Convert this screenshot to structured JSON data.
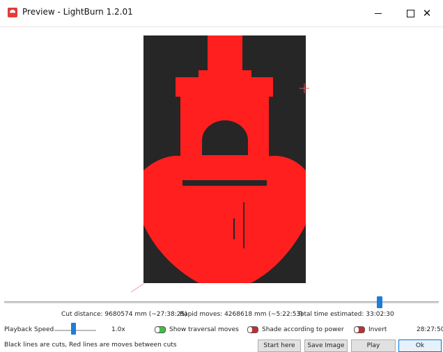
{
  "window": {
    "title": "Preview - LightBurn 1.2.01",
    "minimize_label": "—",
    "maximize_label": "□",
    "close_label": "✕"
  },
  "stats": {
    "cut_distance": "Cut distance: 9680574 mm (~27:38:25)",
    "rapid_moves": "Rapid moves: 4268618 mm (~5:22:53)",
    "total_time": "Total time estimated: 33:02:30"
  },
  "controls": {
    "playback_label": "Playback Speed",
    "speed_value": "1.0x",
    "show_traversal": "Show traversal moves",
    "shade_power": "Shade according to power",
    "invert": "Invert",
    "time_display": "28:27:50"
  },
  "status": {
    "text": "Black lines are cuts, Red lines are moves between cuts"
  },
  "buttons": {
    "start_here": "Start here",
    "save_image": "Save Image",
    "play": "Play",
    "ok": "Ok"
  },
  "progress": {
    "slider_fraction": 0.86,
    "speed_fraction": 0.42
  },
  "toggles": {
    "show_traversal": true,
    "shade_power": false,
    "invert": false
  },
  "colors": {
    "cut_red": "#ff1f1f",
    "background_dark": "#262626",
    "accent_blue": "#1e7dd6"
  }
}
